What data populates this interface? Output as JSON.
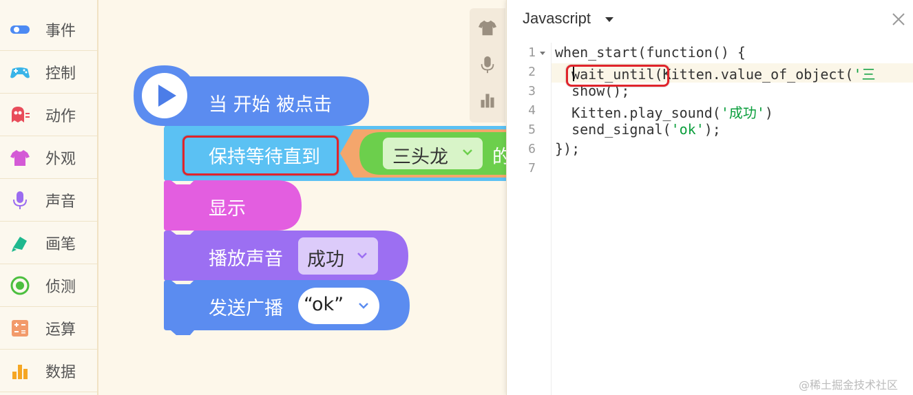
{
  "sidebar": {
    "items": [
      {
        "label": "事件",
        "icon": "toggle-icon",
        "color": "#4c8af3"
      },
      {
        "label": "控制",
        "icon": "gamepad-icon",
        "color": "#39b4e8"
      },
      {
        "label": "动作",
        "icon": "ghost-icon",
        "color": "#e84c5a"
      },
      {
        "label": "外观",
        "icon": "shirt-icon",
        "color": "#d45ad6"
      },
      {
        "label": "声音",
        "icon": "microphone-icon",
        "color": "#9b6cf0"
      },
      {
        "label": "画笔",
        "icon": "pen-icon",
        "color": "#1fb88e"
      },
      {
        "label": "侦测",
        "icon": "target-icon",
        "color": "#4cbf3f"
      },
      {
        "label": "运算",
        "icon": "calculator-icon",
        "color": "#f29a6a"
      },
      {
        "label": "数据",
        "icon": "bar-chart-icon",
        "color": "#f5a623"
      }
    ]
  },
  "tools": [
    "shirt-icon",
    "microphone-icon",
    "bar-chart-icon"
  ],
  "blocks": {
    "hat": {
      "label": "当 开始 被点击",
      "color": "#5b8cf0"
    },
    "wait": {
      "label": "保持等待直到",
      "color": "#5bc1f3"
    },
    "object_select": {
      "value": "三头龙",
      "suffix": "的",
      "color": "#6ccf4c"
    },
    "show": {
      "label": "显示",
      "color": "#e35ee0"
    },
    "play": {
      "label": "播放声音",
      "value": "成功",
      "color": "#9c6ff2"
    },
    "broadcast": {
      "label": "发送广播",
      "value": "“ok”",
      "color": "#5b8cf0"
    }
  },
  "code": {
    "language": "Javascript",
    "line_numbers": [
      "1",
      "2",
      "3",
      "4",
      "5",
      "6",
      "7"
    ],
    "lines": {
      "l1": "when_start(function() {",
      "l2a": "  wait_until(Kitten.value_of_object(",
      "l2b": "'三",
      "l3": "  show();",
      "l4a": "  Kitten.play_sound(",
      "l4b": "'成功'",
      "l4c": ")",
      "l5a": "  send_signal(",
      "l5b": "'ok'",
      "l5c": ");",
      "l6": "});"
    }
  },
  "watermark": "@稀土掘金技术社区"
}
